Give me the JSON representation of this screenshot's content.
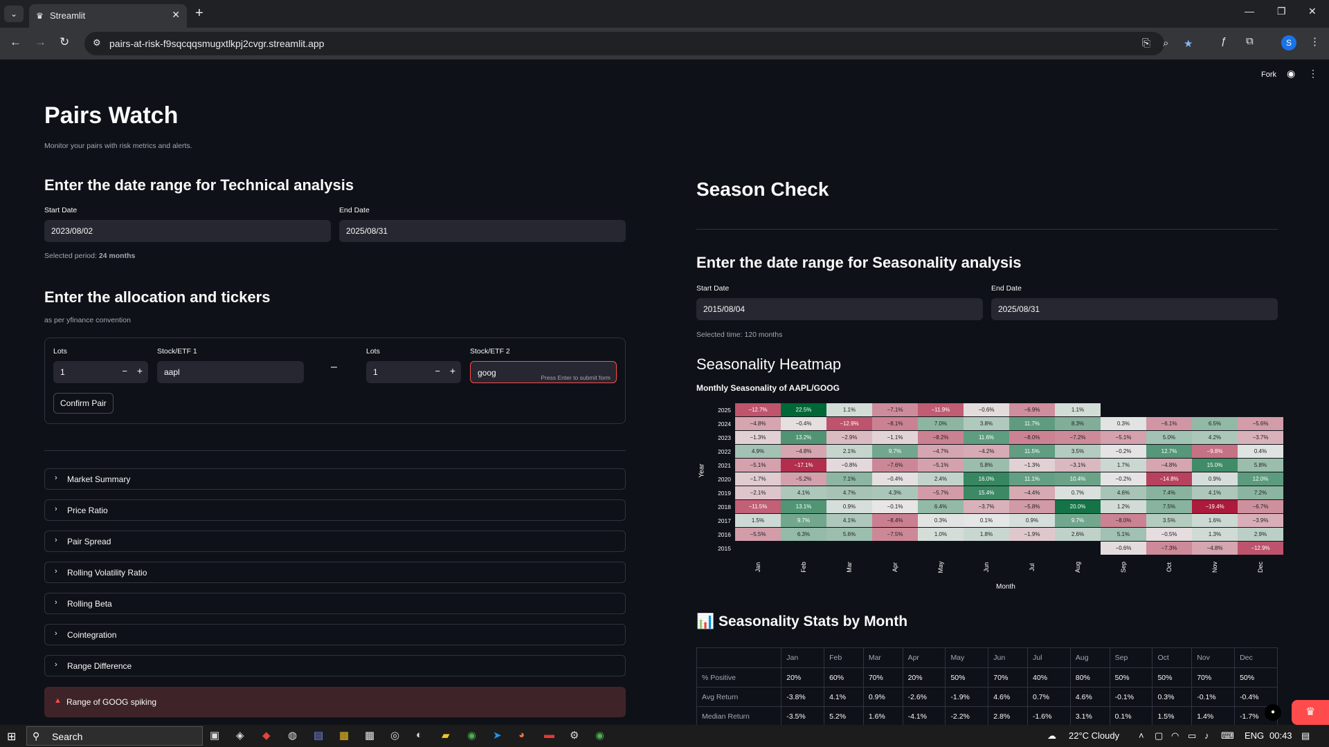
{
  "browser": {
    "tab_title": "Streamlit",
    "url": "pairs-at-risk-f9sqcqqsmugxtlkpj2cvgr.streamlit.app",
    "profile_initial": "S"
  },
  "app_header": {
    "fork_label": "Fork"
  },
  "left": {
    "title": "Pairs Watch",
    "subtitle": "Monitor your pairs with risk metrics and alerts.",
    "tech_heading": "Enter the date range for Technical analysis",
    "start_label": "Start Date",
    "start_value": "2023/08/02",
    "end_label": "End Date",
    "end_value": "2025/08/31",
    "period_prefix": "Selected period: ",
    "period_value": "24 months",
    "alloc_heading": "Enter the allocation and tickers",
    "alloc_caption": "as per yfinance convention",
    "lots1_label": "Lots",
    "lots1_value": "1",
    "stock1_label": "Stock/ETF 1",
    "stock1_value": "aapl",
    "lots2_label": "Lots",
    "lots2_value": "1",
    "stock2_label": "Stock/ETF 2",
    "stock2_value": "goog",
    "press_enter": "Press Enter to submit form",
    "minus_sep": "–",
    "confirm_label": "Confirm Pair",
    "expanders": [
      "Market Summary",
      "Price Ratio",
      "Pair Spread",
      "Rolling Volatility Ratio",
      "Rolling Beta",
      "Cointegration",
      "Range Difference"
    ],
    "alert_text": "Range of GOOG spiking"
  },
  "right": {
    "season_title": "Season Check",
    "season_heading": "Enter the date range for Seasonality analysis",
    "start_label": "Start Date",
    "start_value": "2015/08/04",
    "end_label": "End Date",
    "end_value": "2025/08/31",
    "selected_time": "Selected time: 120 months",
    "heatmap_heading": "Seasonality Heatmap",
    "heatmap_title": "Monthly Seasonality of AAPL/GOOG",
    "y_label": "Year",
    "x_label": "Month",
    "stats_heading": "📊 Seasonality Stats by Month"
  },
  "chart_data": {
    "type": "heatmap",
    "title": "Monthly Seasonality of AAPL/GOOG",
    "xlabel": "Month",
    "ylabel": "Year",
    "x": [
      "Jan",
      "Feb",
      "Mar",
      "Apr",
      "May",
      "Jun",
      "Jul",
      "Aug",
      "Sep",
      "Oct",
      "Nov",
      "Dec"
    ],
    "y": [
      "2025",
      "2024",
      "2023",
      "2022",
      "2021",
      "2020",
      "2019",
      "2018",
      "2017",
      "2016",
      "2015"
    ],
    "values": [
      [
        -12.7,
        22.5,
        1.1,
        -7.1,
        -11.9,
        -0.6,
        -6.9,
        1.1,
        null,
        null,
        null,
        null
      ],
      [
        -4.8,
        -0.4,
        -12.9,
        -8.1,
        7.0,
        3.8,
        11.7,
        8.3,
        0.3,
        -6.1,
        6.5,
        -5.6
      ],
      [
        -1.3,
        13.2,
        -2.9,
        -1.1,
        -8.2,
        11.6,
        -8.0,
        -7.2,
        -5.1,
        5.0,
        4.2,
        -3.7
      ],
      [
        4.9,
        -4.8,
        2.1,
        9.7,
        -4.7,
        -4.2,
        11.5,
        3.5,
        -0.2,
        12.7,
        -9.8,
        0.4
      ],
      [
        -5.1,
        -17.1,
        -0.8,
        -7.6,
        -5.1,
        5.8,
        -1.3,
        -3.1,
        1.7,
        -4.8,
        15.0,
        5.8
      ],
      [
        -1.7,
        -5.2,
        7.1,
        -0.4,
        2.4,
        16.0,
        11.1,
        10.4,
        -0.2,
        -14.8,
        0.9,
        12.0
      ],
      [
        -2.1,
        4.1,
        4.7,
        4.3,
        -5.7,
        15.4,
        -4.4,
        0.7,
        4.6,
        7.4,
        4.1,
        7.2
      ],
      [
        -11.5,
        13.1,
        0.9,
        -0.1,
        6.4,
        -3.7,
        -5.8,
        20.0,
        1.2,
        7.5,
        -19.4,
        -6.7
      ],
      [
        1.5,
        9.7,
        4.1,
        -8.4,
        0.3,
        0.1,
        0.9,
        9.7,
        -8.0,
        3.5,
        1.6,
        -3.9
      ],
      [
        -5.5,
        6.3,
        5.6,
        -7.5,
        1.0,
        1.8,
        -1.9,
        2.6,
        5.1,
        -0.5,
        1.3,
        2.9
      ],
      [
        null,
        null,
        null,
        null,
        null,
        null,
        null,
        null,
        -0.6,
        -7.3,
        -4.8,
        -12.9
      ]
    ],
    "colorscale": {
      "negative": "#a50026",
      "zero": "#e8e8e8",
      "positive": "#006837"
    }
  },
  "stats": {
    "columns": [
      "",
      "Jan",
      "Feb",
      "Mar",
      "Apr",
      "May",
      "Jun",
      "Jul",
      "Aug",
      "Sep",
      "Oct",
      "Nov",
      "Dec"
    ],
    "rows": [
      [
        "% Positive",
        "20%",
        "60%",
        "70%",
        "20%",
        "50%",
        "70%",
        "40%",
        "80%",
        "50%",
        "50%",
        "70%",
        "50%"
      ],
      [
        "Avg Return",
        "-3.8%",
        "4.1%",
        "0.9%",
        "-2.6%",
        "-1.9%",
        "4.6%",
        "0.7%",
        "4.6%",
        "-0.1%",
        "0.3%",
        "-0.1%",
        "-0.4%"
      ],
      [
        "Median Return",
        "-3.5%",
        "5.2%",
        "1.6%",
        "-4.1%",
        "-2.2%",
        "2.8%",
        "-1.6%",
        "3.1%",
        "0.1%",
        "1.5%",
        "1.4%",
        "-1.7%"
      ]
    ]
  },
  "taskbar": {
    "search_label": "Search",
    "weather": "22°C  Cloudy",
    "lang": "ENG",
    "time": "00:43"
  }
}
